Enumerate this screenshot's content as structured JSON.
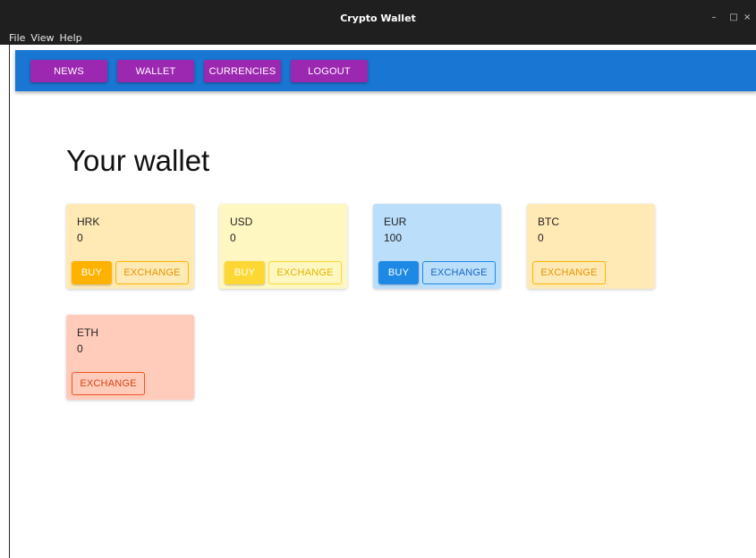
{
  "window": {
    "title": "Crypto Wallet",
    "controls": {
      "minimize": "–",
      "maximize": "□",
      "close": "×"
    }
  },
  "menu": [
    "File",
    "View",
    "Help"
  ],
  "nav": {
    "items": [
      {
        "label": "NEWS"
      },
      {
        "label": "WALLET"
      },
      {
        "label": "CURRENCIES"
      },
      {
        "label": "LOGOUT"
      }
    ]
  },
  "page": {
    "title": "Your wallet"
  },
  "wallet": [
    {
      "currency": "HRK",
      "amount": "0",
      "buy_label": "BUY",
      "exchange_label": "EXCHANGE"
    },
    {
      "currency": "USD",
      "amount": "0",
      "buy_label": "BUY",
      "exchange_label": "EXCHANGE"
    },
    {
      "currency": "EUR",
      "amount": "100",
      "buy_label": "BUY",
      "exchange_label": "EXCHANGE"
    },
    {
      "currency": "BTC",
      "amount": "0",
      "exchange_label": "EXCHANGE"
    },
    {
      "currency": "ETH",
      "amount": "0",
      "exchange_label": "EXCHANGE"
    }
  ],
  "colors": {
    "appbar": "#1976d2",
    "nav_button": "#9c27b0",
    "titlebar": "#1f1f1f",
    "hrk_card": "#ffe9b5",
    "hrk_accent": "#ffb300",
    "usd_card": "#fff7c2",
    "usd_accent": "#fdd835",
    "eur_card": "#bbdefb",
    "eur_accent": "#1e88e5",
    "btc_card": "#ffe9b5",
    "btc_accent": "#ffb300",
    "eth_card": "#ffccbc",
    "eth_accent": "#f4511e"
  }
}
